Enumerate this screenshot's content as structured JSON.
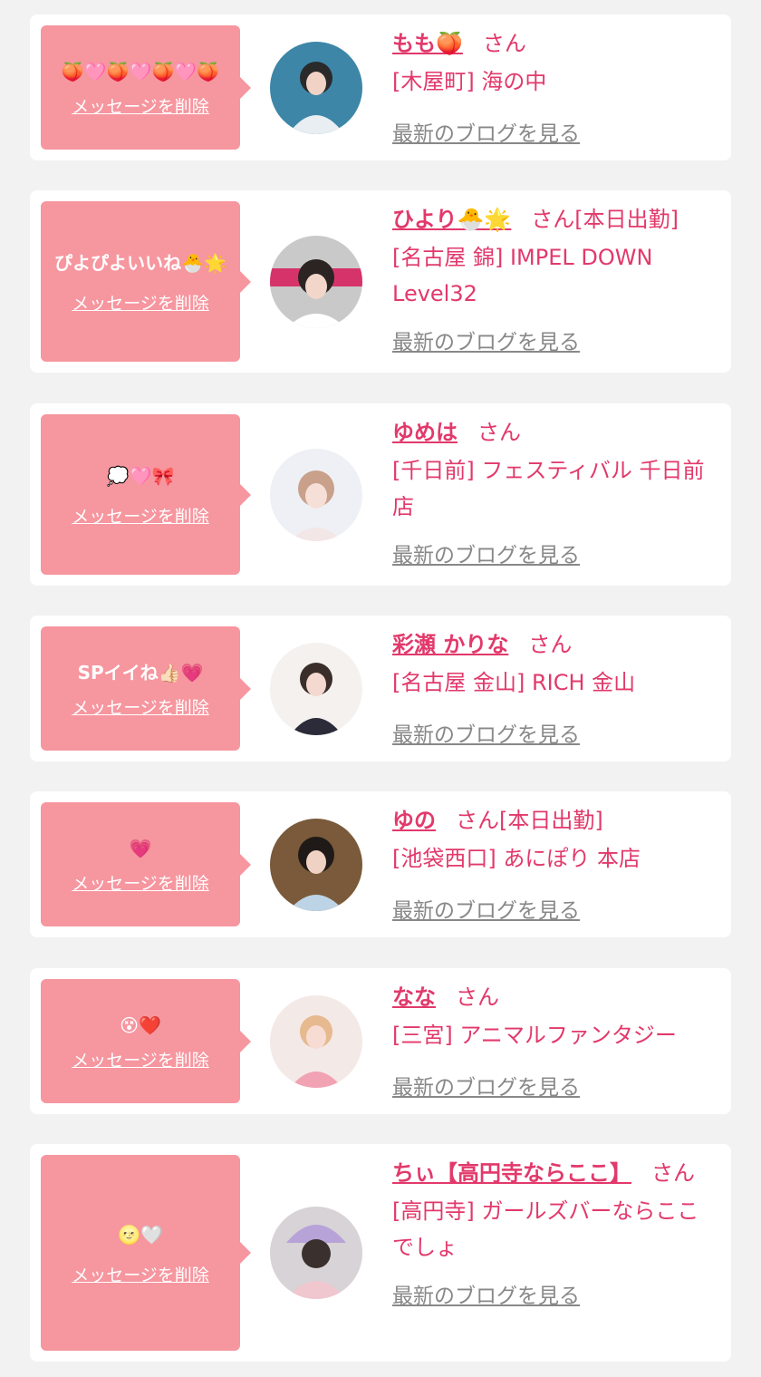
{
  "delete_label": "メッセージを削除",
  "blog_label": "最新のブログを見る",
  "honorific": "さん",
  "colors": {
    "bubble": "#f6969f",
    "accent": "#e2396b",
    "link_gray": "#888888",
    "bg": "#f2f2f2"
  },
  "cards": [
    {
      "message": "🍑🩷🍑🩷🍑🩷🍑",
      "name": "もも🍑",
      "status": "",
      "shop": "[木屋町] 海の中",
      "avatar": "photo"
    },
    {
      "message": "ぴよぴよいいね🐣🌟",
      "name": "ひより🐣🌟",
      "status": "[本日出勤]",
      "shop": "[名古屋 錦] IMPEL DOWN Level32",
      "avatar": "photo"
    },
    {
      "message": "💭🩷🎀",
      "name": "ゆめは",
      "status": "",
      "shop": "[千日前] フェスティバル 千日前店",
      "avatar": "photo"
    },
    {
      "message": "SPイイね👍🏻💗",
      "name": "彩瀬 かりな",
      "status": "",
      "shop": "[名古屋 金山] RICH 金山",
      "avatar": "photo"
    },
    {
      "message": "💗",
      "name": "ゆの",
      "status": "[本日出勤]",
      "shop": "[池袋西口] あにぽり 本店",
      "avatar": "photo"
    },
    {
      "message": "😵❤️",
      "name": "なな",
      "status": "",
      "shop": "[三宮] アニマルファンタジー",
      "avatar": "photo"
    },
    {
      "message": "🌝🤍",
      "name": "ちぃ【高円寺ならここ】",
      "status": "",
      "shop": "[高円寺] ガールズバーならここでしょ",
      "avatar": "photo"
    }
  ]
}
